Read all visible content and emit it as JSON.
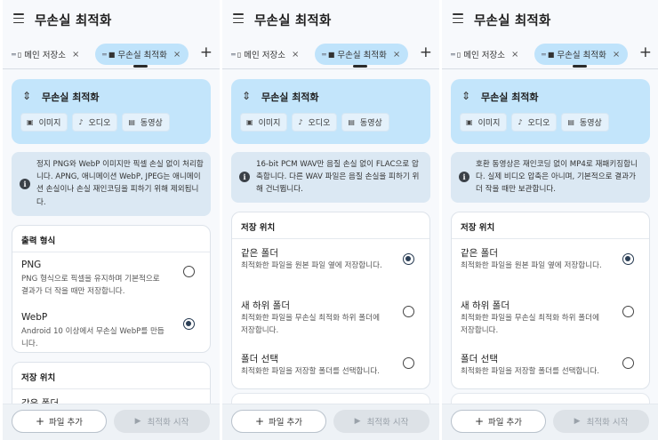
{
  "app": {
    "title": "무손실 최적화"
  },
  "tabs": [
    {
      "label": "메인 저장소",
      "close": "×"
    },
    {
      "label": "무손실 최적화",
      "close": "×"
    }
  ],
  "add_tab": "+",
  "header_card": {
    "title": "무손실 최적화",
    "chips": [
      "이미지",
      "오디오",
      "동영상"
    ]
  },
  "screens": [
    {
      "info": "정지 PNG와 WebP 이미지만 픽셀 손실 없이 처리합니다. APNG, 애니메이션 WebP, JPEG는 애니메이션 손실이나 손실 재인코딩을 피하기 위해 제외됩니다.",
      "output_section": {
        "title": "출력 형식",
        "options": [
          {
            "title": "PNG",
            "desc": "PNG 형식으로 픽셀을 유지하며 기본적으로 결과가 더 작을 때만 저장합니다.",
            "selected": false
          },
          {
            "title": "WebP",
            "desc": "Android 10 이상에서 무손실 WebP를 만듭니다.",
            "selected": true
          }
        ]
      },
      "storage_section": {
        "title": "저장 위치",
        "partial_option": "같은 폴더"
      }
    },
    {
      "info": "16-bit PCM WAV만 음질 손실 없이 FLAC으로 압축합니다. 다른 WAV 파일은 음질 손실을 피하기 위해 건너뜁니다.",
      "storage_section": {
        "title": "저장 위치",
        "options": [
          {
            "title": "같은 폴더",
            "desc": "최적화한 파일을 원본 파일 옆에 저장합니다.",
            "selected": true
          },
          {
            "title": "새 하위 폴더",
            "desc": "최적화한 파일을 무손실 최적화 하위 폴더에 저장합니다.",
            "selected": false
          },
          {
            "title": "폴더 선택",
            "desc": "최적화한 파일을 저장할 폴더를 선택합니다.",
            "selected": false
          }
        ]
      }
    },
    {
      "info": "호환 동영상은 재인코딩 없이 MP4로 재패키징합니다. 실제 비디오 압축은 아니며, 기본적으로 결과가 더 작을 때만 보관합니다.",
      "storage_section": {
        "title": "저장 위치",
        "options": [
          {
            "title": "같은 폴더",
            "desc": "최적화한 파일을 원본 파일 옆에 저장합니다.",
            "selected": true
          },
          {
            "title": "새 하위 폴더",
            "desc": "최적화한 파일을 무손실 최적화 하위 폴더에 저장합니다.",
            "selected": false
          },
          {
            "title": "폴더 선택",
            "desc": "최적화한 파일을 저장할 폴더를 선택합니다.",
            "selected": false
          }
        ]
      }
    }
  ],
  "bottom": {
    "add_files": "파일 추가",
    "start": "최적화 시작"
  },
  "colors": {
    "accent_card": "#c3e5fb",
    "selected_tab": "#bfe3fb",
    "info_card": "#dbe8f3",
    "radio_on": "#2b3f56"
  },
  "icons": {
    "menu": "menu-icon",
    "compress": "compress-icon",
    "image": "image-icon",
    "audio": "audio-file-icon",
    "video": "video-icon",
    "info": "info-icon",
    "phone": "phone-icon",
    "folder": "folder-icon",
    "add": "plus-icon",
    "play": "play-icon"
  }
}
